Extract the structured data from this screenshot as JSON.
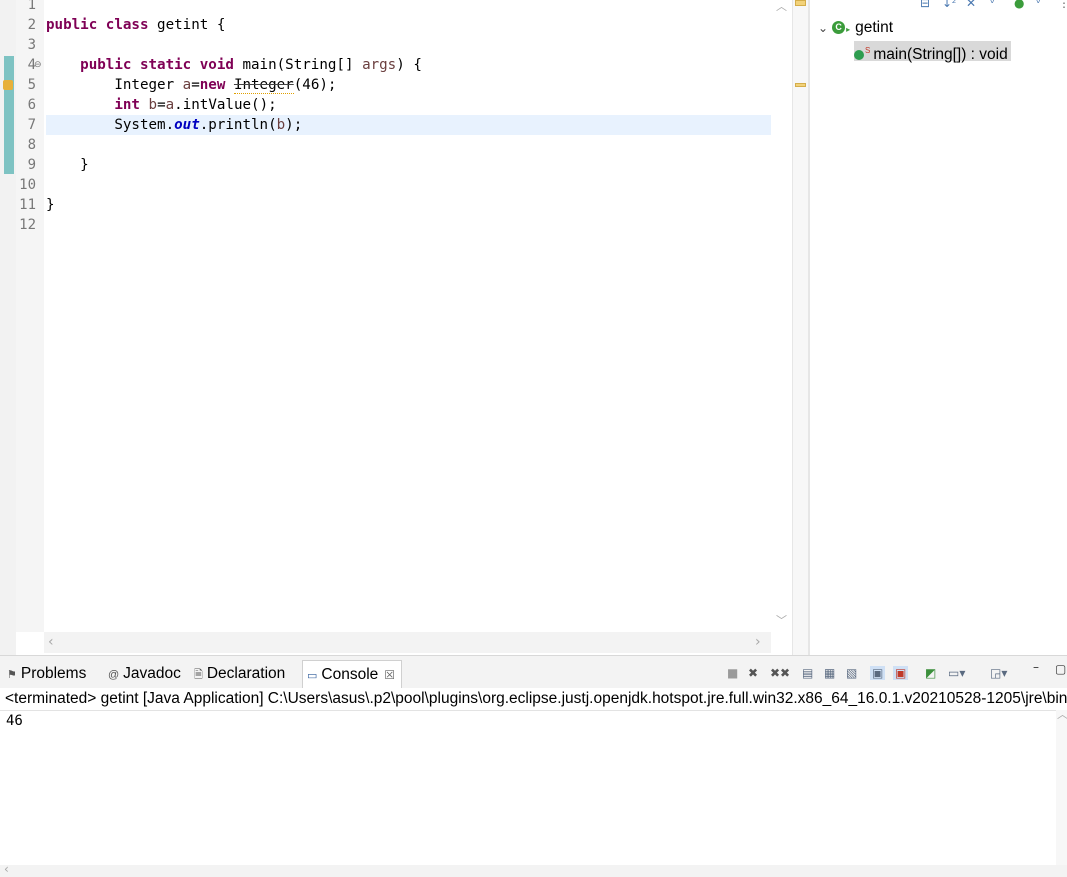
{
  "editor": {
    "line_numbers": [
      "1",
      "2",
      "3",
      "4",
      "5",
      "6",
      "7",
      "8",
      "9",
      "10",
      "11",
      "12"
    ],
    "lines": [
      {
        "tokens": []
      },
      {
        "tokens": [
          {
            "t": "public",
            "c": "kw"
          },
          {
            "t": " "
          },
          {
            "t": "class",
            "c": "kw"
          },
          {
            "t": " getint {"
          }
        ]
      },
      {
        "tokens": []
      },
      {
        "tokens": [
          {
            "t": "    "
          },
          {
            "t": "public",
            "c": "kw"
          },
          {
            "t": " "
          },
          {
            "t": "static",
            "c": "kw"
          },
          {
            "t": " "
          },
          {
            "t": "void",
            "c": "kw"
          },
          {
            "t": " main(String[] "
          },
          {
            "t": "args",
            "c": "var"
          },
          {
            "t": ") {"
          }
        ]
      },
      {
        "tokens": [
          {
            "t": "        Integer "
          },
          {
            "t": "a",
            "c": "var"
          },
          {
            "t": "="
          },
          {
            "t": "new",
            "c": "kw"
          },
          {
            "t": " "
          },
          {
            "t": "Integer",
            "c": "deprecated"
          },
          {
            "t": "(46);"
          }
        ]
      },
      {
        "tokens": [
          {
            "t": "        "
          },
          {
            "t": "int",
            "c": "kw"
          },
          {
            "t": " "
          },
          {
            "t": "b",
            "c": "var"
          },
          {
            "t": "="
          },
          {
            "t": "a",
            "c": "var"
          },
          {
            "t": ".intValue();"
          }
        ]
      },
      {
        "tokens": [
          {
            "t": "        System."
          },
          {
            "t": "out",
            "c": "field"
          },
          {
            "t": ".println("
          },
          {
            "t": "b",
            "c": "var"
          },
          {
            "t": ");"
          }
        ]
      },
      {
        "tokens": []
      },
      {
        "tokens": [
          {
            "t": "    }"
          }
        ]
      },
      {
        "tokens": []
      },
      {
        "tokens": [
          {
            "t": "}"
          }
        ]
      },
      {
        "tokens": []
      }
    ],
    "current_line": 7
  },
  "outline": {
    "class_name": "getint",
    "method_label": "main(String[]) : void",
    "method_modifier": "S"
  },
  "bottom": {
    "tabs": [
      {
        "label": "Problems",
        "icon": "problems-icon"
      },
      {
        "label": "Javadoc",
        "icon": "javadoc-icon"
      },
      {
        "label": "Declaration",
        "icon": "declaration-icon"
      },
      {
        "label": "Console",
        "icon": "console-icon"
      }
    ],
    "console_header": "<terminated> getint [Java Application] C:\\Users\\asus\\.p2\\pool\\plugins\\org.eclipse.justj.openjdk.hotspot.jre.full.win32.x86_64_16.0.1.v20210528-1205\\jre\\bin\\javaw.exe",
    "console_output": [
      "46"
    ]
  },
  "colors": {
    "keyword": "#7f0055",
    "variable": "#6a3e3e",
    "field": "#0000c0",
    "current_line": "#e8f2fe",
    "change_bar": "#7ec3c3"
  }
}
